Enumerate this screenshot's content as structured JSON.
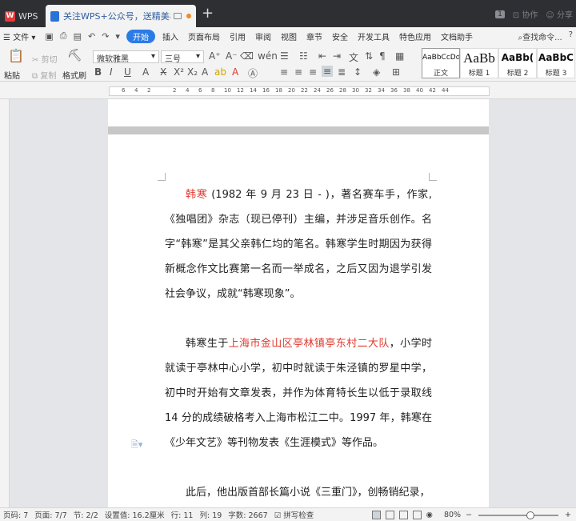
{
  "titlebar": {
    "app_tab": "WPS",
    "doc_tab": "关注WPS+公众号，送精美模板",
    "new_tab": "+",
    "badge": "1",
    "collab": "协作",
    "share": "分享"
  },
  "menu": {
    "file": "文件",
    "items": [
      "开始",
      "插入",
      "页面布局",
      "引用",
      "审阅",
      "视图",
      "章节",
      "安全",
      "开发工具",
      "特色应用",
      "文档助手"
    ],
    "search": "查找命令..."
  },
  "ribbon": {
    "cut": "剪切",
    "copy": "复制",
    "paste": "粘贴",
    "format_painter": "格式刷",
    "font_name": "微软雅黑",
    "font_size": "三号",
    "styles": [
      {
        "preview": "AaBbCcDd",
        "name": "正文"
      },
      {
        "preview": "AaBb",
        "name": "标题 1"
      },
      {
        "preview": "AaBb(",
        "name": "标题 2"
      },
      {
        "preview": "AaBbC",
        "name": "标题 3"
      }
    ]
  },
  "ruler": {
    "ticks": [
      "6",
      "4",
      "2",
      "",
      "2",
      "4",
      "6",
      "8",
      "10",
      "12",
      "14",
      "16",
      "18",
      "20",
      "22",
      "24",
      "26",
      "28",
      "30",
      "32",
      "34",
      "36",
      "38",
      "40",
      "42",
      "44"
    ]
  },
  "document": {
    "p1_name": "韩寒",
    "p1_rest": " (1982 年 9 月 23 日 - )，著名赛车手，作家,《独唱团》杂志（现已停刊）主编，并涉足音乐创作。名字“韩寒”是其父亲韩仁均的笔名。韩寒学生时期因为获得新概念作文比赛第一名而一举成名，之后又因为退学引发社会争议，成就“韩寒现象”。",
    "p2_start": "韩寒生于",
    "p2_place": "上海市金山区亭林镇亭东村二大队",
    "p2_rest": "，小学时就读于亭林中心小学，初中时就读于朱泾镇的罗星中学，初中时开始有文章发表，并作为体育特长生以低于录取线 14 分的成绩破格考入上海市松江二中。1997 年，韩寒在《少年文艺》等刊物发表《生涯模式》等作品。",
    "p3": "此后，他出版首部长篇小说《三重门》，创畅销纪录，"
  },
  "status": {
    "page_no": "页码: 7",
    "pages": "页面: 7/7",
    "section": "节: 2/2",
    "setting": "设置值: 16.2厘米",
    "row": "行: 11",
    "col": "列: 19",
    "words": "字数: 2667",
    "spell": "拼写检查",
    "zoom": "80%",
    "minus": "−",
    "plus": "+"
  }
}
